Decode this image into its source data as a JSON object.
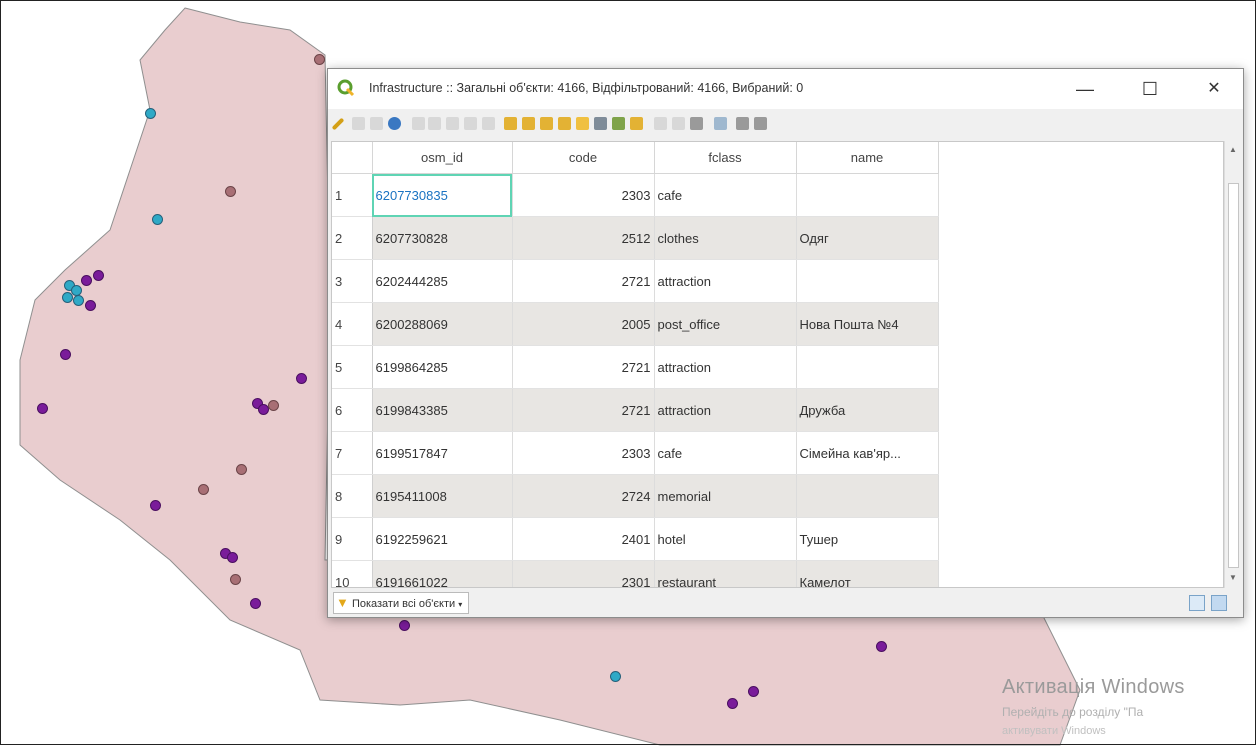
{
  "window": {
    "title": "Infrastructure :: Загальні об'єкти: 4166, Відфільтрований: 4166, Вибраний: 0",
    "minimize_glyph": "—",
    "maximize_glyph": "☐",
    "close_glyph": "✕"
  },
  "table": {
    "columns": [
      "osm_id",
      "code",
      "fclass",
      "name"
    ],
    "rows": [
      {
        "n": "1",
        "osm_id": "6207730835",
        "code": "2303",
        "fclass": "cafe",
        "name": ""
      },
      {
        "n": "2",
        "osm_id": "6207730828",
        "code": "2512",
        "fclass": "clothes",
        "name": "Одяг"
      },
      {
        "n": "3",
        "osm_id": "6202444285",
        "code": "2721",
        "fclass": "attraction",
        "name": ""
      },
      {
        "n": "4",
        "osm_id": "6200288069",
        "code": "2005",
        "fclass": "post_office",
        "name": "Нова Пошта №4"
      },
      {
        "n": "5",
        "osm_id": "6199864285",
        "code": "2721",
        "fclass": "attraction",
        "name": ""
      },
      {
        "n": "6",
        "osm_id": "6199843385",
        "code": "2721",
        "fclass": "attraction",
        "name": "Дружба"
      },
      {
        "n": "7",
        "osm_id": "6199517847",
        "code": "2303",
        "fclass": "cafe",
        "name": "Сімейна кав'яр..."
      },
      {
        "n": "8",
        "osm_id": "6195411008",
        "code": "2724",
        "fclass": "memorial",
        "name": ""
      },
      {
        "n": "9",
        "osm_id": "6192259621",
        "code": "2401",
        "fclass": "hotel",
        "name": "Тушер"
      },
      {
        "n": "10",
        "osm_id": "6191661022",
        "code": "2301",
        "fclass": "restaurant",
        "name": "Камелот"
      }
    ]
  },
  "filter_button": {
    "label": "Показати всі об'єкти",
    "icon": "filter-funnel-icon"
  },
  "watermark": {
    "line1": "Активація Windows",
    "line2": "Перейдіть до розділу \"Па",
    "line3": "активувати Windows"
  },
  "colors": {
    "map_fill": "#e9cdcf",
    "map_stroke": "#8f8f8f",
    "point_cyan": "#2fa9c6",
    "point_purple": "#7a1c9a",
    "point_brown": "#a86f75",
    "selection_outline": "#5fd4b4",
    "qgis_green": "#5a9e2e"
  }
}
